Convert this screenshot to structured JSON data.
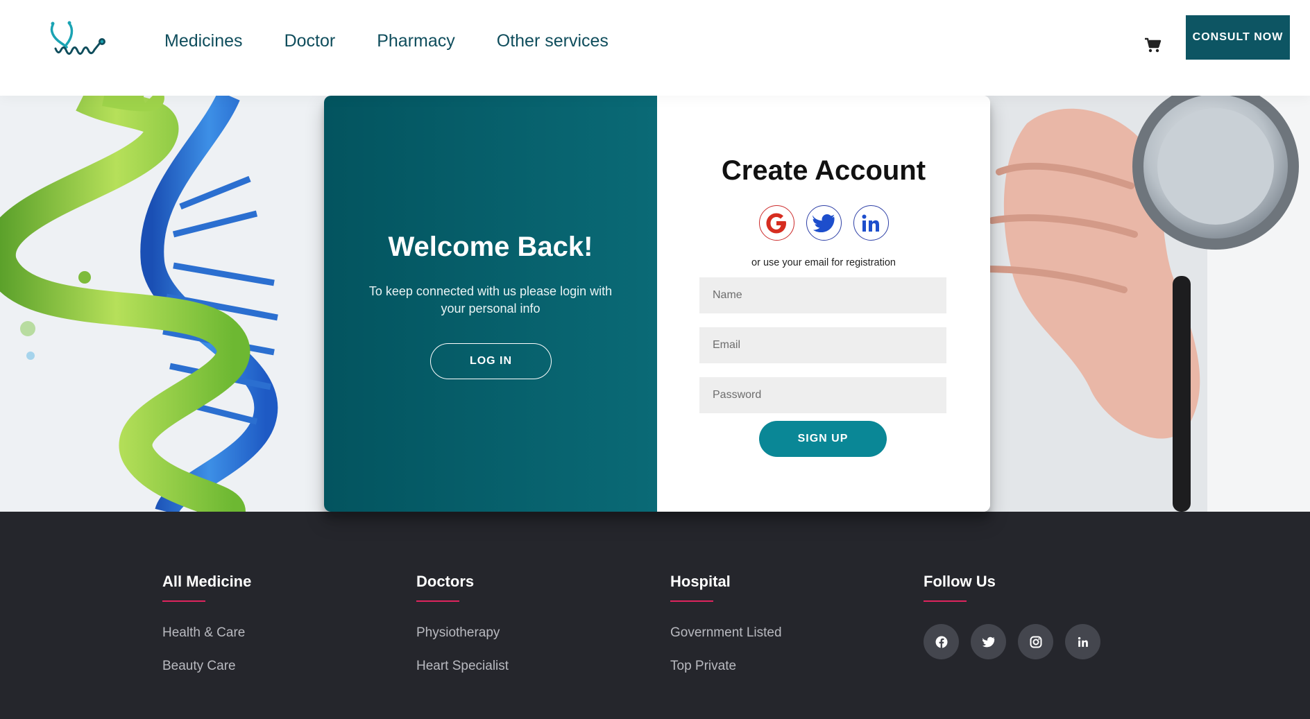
{
  "nav": {
    "items": [
      "Medicines",
      "Doctor",
      "Pharmacy",
      "Other services"
    ],
    "consult_label": "CONSULT NOW",
    "cart_icon": "cart-icon",
    "logo_icon": "stethoscope-logo"
  },
  "welcome": {
    "title": "Welcome Back!",
    "text": "To keep connected with us please login with your personal info",
    "login_label": "LOG IN"
  },
  "signup": {
    "title": "Create Account",
    "socials": [
      "google-icon",
      "twitter-icon",
      "linkedin-icon"
    ],
    "note": "or use your email for registration",
    "name_placeholder": "Name",
    "email_placeholder": "Email",
    "password_placeholder": "Password",
    "signup_label": "SIGN UP"
  },
  "footer": {
    "columns": [
      {
        "title": "All Medicine",
        "links": [
          "Health & Care",
          "Beauty Care"
        ]
      },
      {
        "title": "Doctors",
        "links": [
          "Physiotherapy",
          "Heart Specialist"
        ]
      },
      {
        "title": "Hospital",
        "links": [
          "Government Listed",
          "Top Private"
        ]
      }
    ],
    "follow_title": "Follow Us",
    "follow_icons": [
      "facebook-icon",
      "twitter-icon",
      "instagram-icon",
      "linkedin-icon"
    ]
  },
  "colors": {
    "teal_dark": "#03545f",
    "teal_button": "#0a8796",
    "footer_bg": "#25262c",
    "accent_underline": "#e0245e"
  }
}
